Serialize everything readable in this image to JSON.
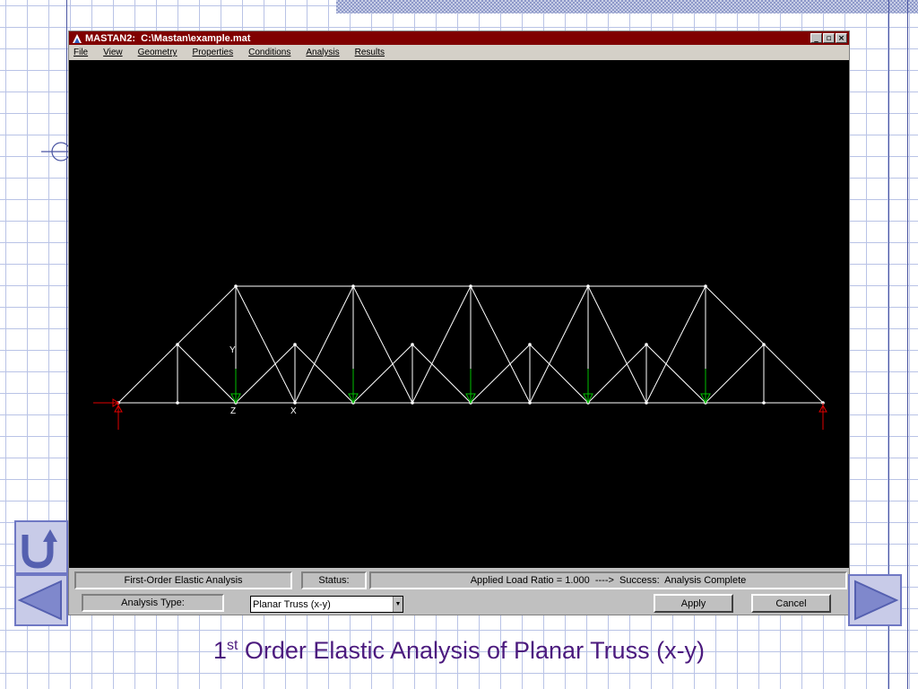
{
  "window": {
    "title": "MASTAN2:  C:\\Mastan\\example.mat",
    "controls": [
      "_",
      "▫",
      "×"
    ]
  },
  "menu": [
    "File",
    "View",
    "Geometry",
    "Properties",
    "Conditions",
    "Analysis",
    "Results"
  ],
  "canvas": {
    "axis_labels": {
      "y": "Y",
      "z": "Z",
      "x": "X"
    }
  },
  "status": {
    "analysis_name": "First-Order Elastic Analysis",
    "status_label": "Status:",
    "status_message": "Applied Load Ratio = 1.000  ---->  Success:  Analysis Complete",
    "analysis_type_label": "Analysis Type:",
    "analysis_type_value": "Planar Truss (x-y)",
    "apply_label": "Apply",
    "cancel_label": "Cancel"
  },
  "slide": {
    "caption_num": "1",
    "caption_sup": "st",
    "caption_rest": " Order Elastic Analysis of Planar Truss (x-y)"
  },
  "colors": {
    "title_bar": "#800000",
    "canvas_bg": "#000000",
    "members": "#ffffff",
    "loads": "#00c000",
    "supports": "#e00000",
    "caption": "#4b1a7e",
    "nav": "#c8cbe8"
  },
  "icons": [
    "app-icon",
    "minimize-icon",
    "restore-icon",
    "close-icon",
    "dropdown-arrow-icon",
    "return-icon",
    "previous-arrow-icon",
    "next-arrow-icon"
  ]
}
